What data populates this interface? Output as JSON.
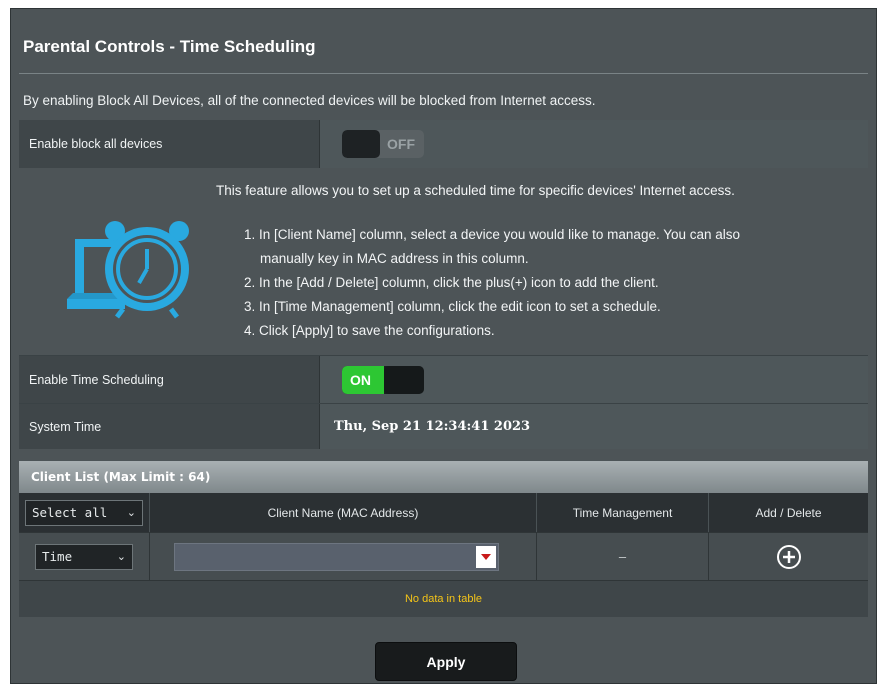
{
  "page": {
    "title": "Parental Controls - Time Scheduling",
    "description": "By enabling Block All Devices, all of the connected devices will be blocked from Internet access."
  },
  "block_all": {
    "label": "Enable block all devices",
    "state_text": "OFF"
  },
  "feature": {
    "intro": "This feature allows you to set up a scheduled time for specific devices' Internet access.",
    "steps": [
      "1. In [Client Name] column, select a device you would like to manage. You can also",
      "manually key in MAC address in this column.",
      "2. In the [Add / Delete] column, click the plus(+) icon to add the client.",
      "3. In [Time Management] column, click the edit icon to set a schedule.",
      "4. Click [Apply] to save the configurations."
    ]
  },
  "time_scheduling": {
    "label": "Enable Time Scheduling",
    "state_text": "ON"
  },
  "system_time": {
    "label": "System Time",
    "value": "Thu, Sep 21 12:34:41 2023"
  },
  "client_list": {
    "header": "Client List (Max Limit : 64)",
    "select_all": "Select all",
    "columns": [
      "Client Name (MAC Address)",
      "Time Management",
      "Add / Delete"
    ],
    "row": {
      "type_value": "Time",
      "client_value": "",
      "time_management": "–"
    },
    "empty_text": "No data in table"
  },
  "apply_label": "Apply",
  "colors": {
    "on_green": "#2dc733",
    "accent_cyan": "#29a9e0",
    "empty_yellow": "#f5c518"
  }
}
